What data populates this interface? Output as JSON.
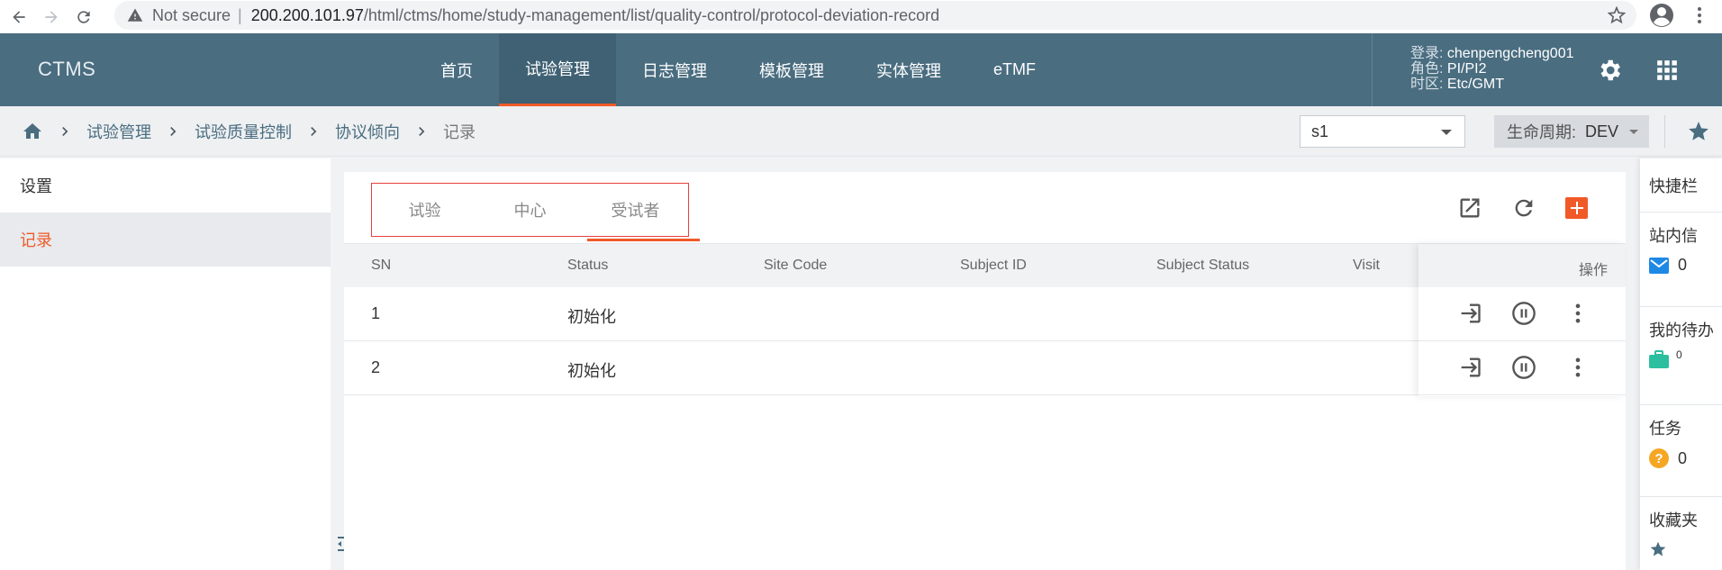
{
  "browser": {
    "security": "Not secure",
    "url_host": "200.200.101.97",
    "url_path": "/html/ctms/home/study-management/list/quality-control/protocol-deviation-record"
  },
  "header": {
    "logo": "CTMS",
    "nav": [
      {
        "label": "首页",
        "active": false
      },
      {
        "label": "试验管理",
        "active": true
      },
      {
        "label": "日志管理",
        "active": false
      },
      {
        "label": "模板管理",
        "active": false
      },
      {
        "label": "实体管理",
        "active": false
      },
      {
        "label": "eTMF",
        "active": false
      }
    ],
    "user": {
      "login_label": "登录: ",
      "login_value": "chenpengcheng001",
      "role_label": "角色: ",
      "role_value": "PI/PI2",
      "tz_label": "时区: ",
      "tz_value": "Etc/GMT"
    },
    "accent_color": "#f05a28",
    "header_color": "#4a6d80"
  },
  "breadcrumb": {
    "items": [
      "试验管理",
      "试验质量控制",
      "协议倾向",
      "记录"
    ],
    "study_select": "s1",
    "lifecycle_label": "生命周期:",
    "lifecycle_value": "DEV"
  },
  "sidebar": {
    "items": [
      {
        "label": "设置",
        "active": false
      },
      {
        "label": "记录",
        "active": true
      }
    ]
  },
  "main": {
    "tabs": [
      {
        "label": "试验",
        "active": false
      },
      {
        "label": "中心",
        "active": false
      },
      {
        "label": "受试者",
        "active": true
      }
    ],
    "columns": [
      "SN",
      "Status",
      "Site Code",
      "Subject ID",
      "Subject Status",
      "Visit"
    ],
    "ops_header": "操作",
    "rows": [
      {
        "sn": "1",
        "status": "初始化",
        "site_code": "",
        "subject_id": "",
        "subject_status": "",
        "visit": ""
      },
      {
        "sn": "2",
        "status": "初始化",
        "site_code": "",
        "subject_id": "",
        "subject_status": "",
        "visit": ""
      }
    ]
  },
  "quick": {
    "title": "快捷栏",
    "sections": [
      {
        "label": "站内信",
        "count": "0",
        "icon": "mail-icon"
      },
      {
        "label": "我的待办",
        "count": "0",
        "icon": "briefcase-icon"
      },
      {
        "label": "任务",
        "count": "0",
        "icon": "question-icon"
      },
      {
        "label": "收藏夹",
        "count": "",
        "icon": "star-icon"
      }
    ]
  }
}
